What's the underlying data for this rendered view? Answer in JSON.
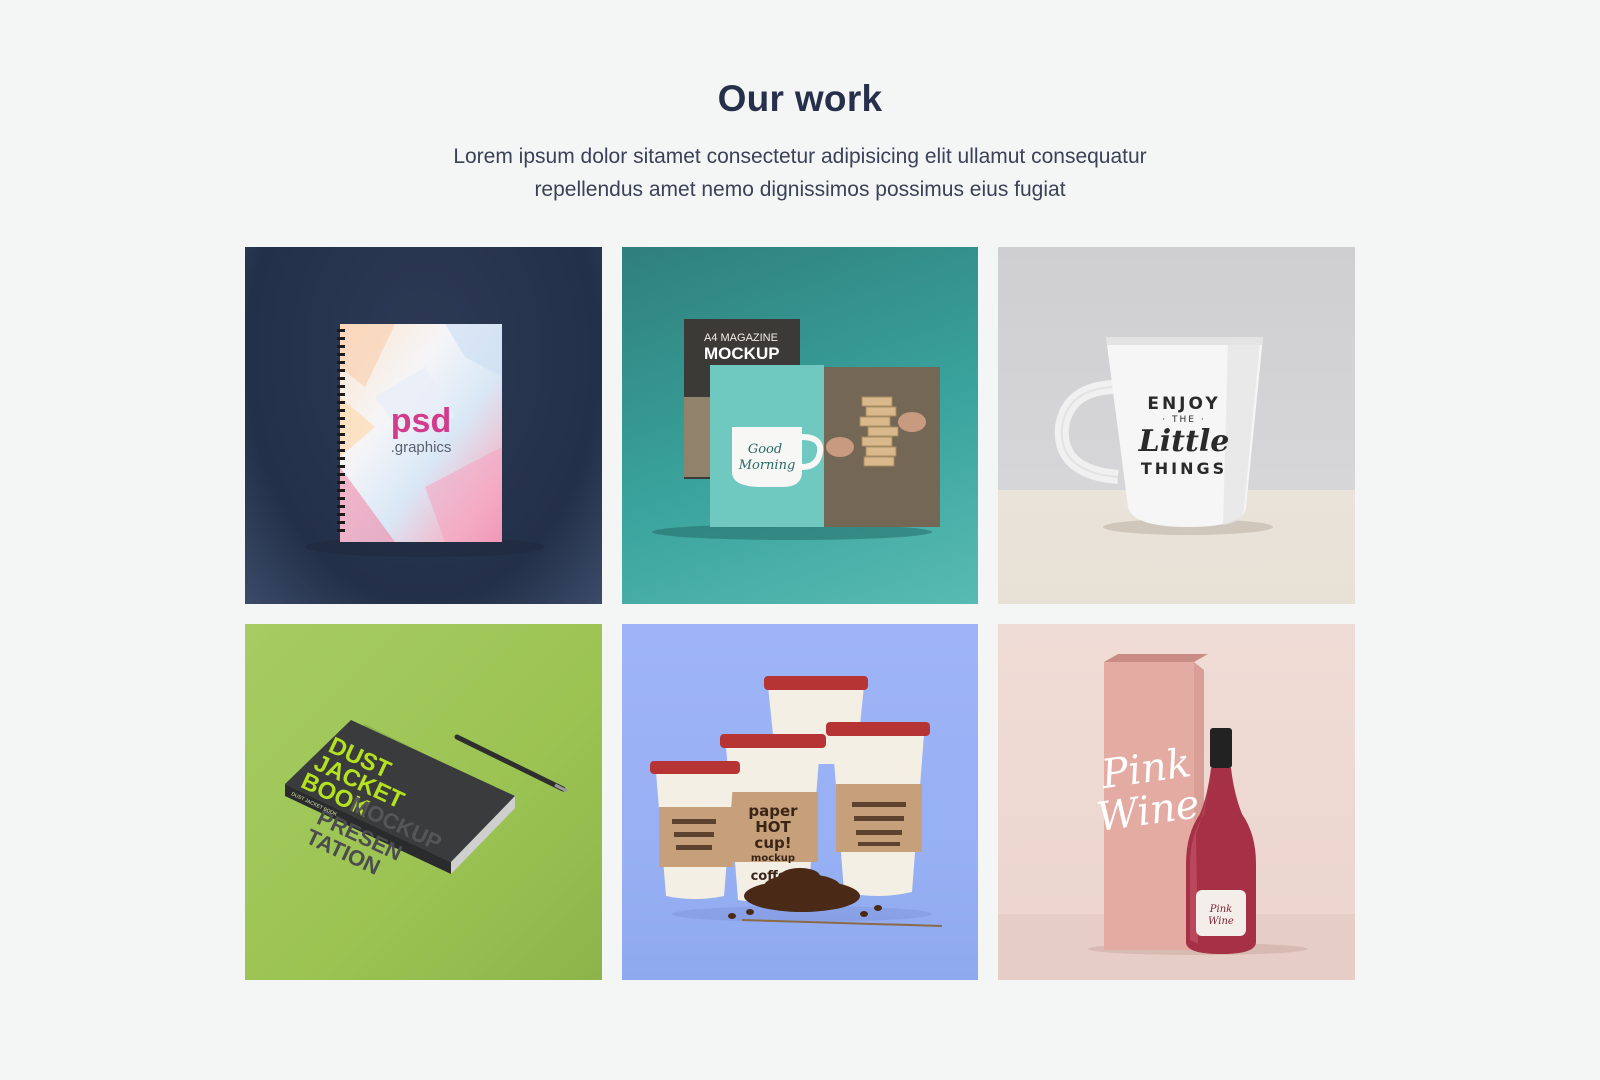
{
  "section": {
    "title": "Our work",
    "description_line1": "Lorem ipsum dolor sitamet consectetur adipisicing elit ullamut consequatur",
    "description_line2": "repellendus amet nemo dignissimos possimus eius fugiat"
  },
  "portfolio": [
    {
      "name": "notebook-mockup",
      "texts": {
        "logo_main": "psd",
        "logo_sub": ".graphics"
      }
    },
    {
      "name": "magazine-mockup",
      "texts": {
        "line1": "A4 MAGAZINE",
        "line2": "MOCKUP",
        "mug_text_1": "Good",
        "mug_text_2": "Morning"
      }
    },
    {
      "name": "mug-mockup",
      "texts": {
        "line1": "ENJOY",
        "line2": "· THE ·",
        "line3": "Little",
        "line4": "THINGS"
      }
    },
    {
      "name": "book-mockup",
      "texts": {
        "line1": "DUST",
        "line2": "JACKET",
        "line3": "BOOK",
        "line4": "MOCKUP",
        "line5": "PRESEN",
        "line6": "TATION",
        "spine": "DUST JACKET BOOK"
      }
    },
    {
      "name": "coffee-cups-mockup",
      "texts": {
        "line1": "paper",
        "line2": "HOT",
        "line3": "cup!",
        "line4": "mockup",
        "line5": "coffee"
      }
    },
    {
      "name": "wine-mockup",
      "texts": {
        "line1": "Pink",
        "line2": "Wine"
      }
    }
  ]
}
